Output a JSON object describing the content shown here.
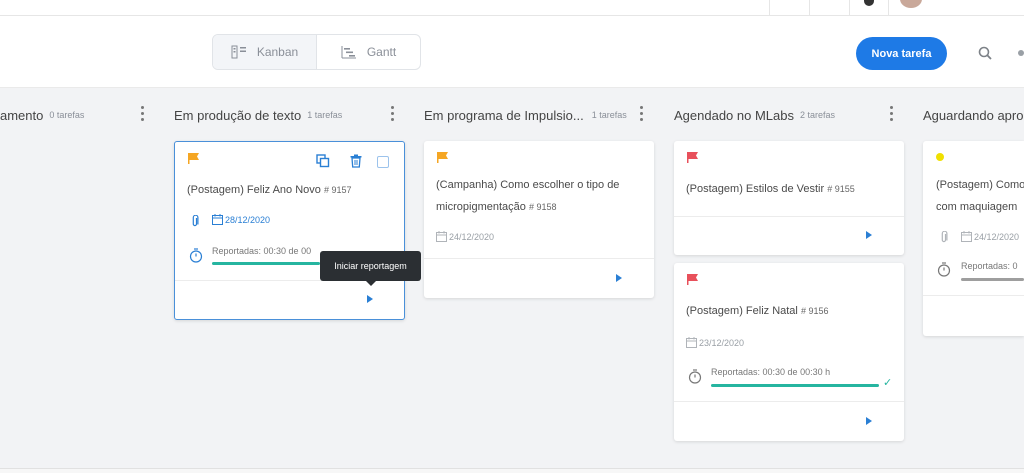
{
  "toolbar": {
    "views": [
      {
        "label": "Kanban",
        "active": true
      },
      {
        "label": "Gantt",
        "active": false
      }
    ],
    "new_task_label": "Nova tarefa"
  },
  "columns": [
    {
      "title": "amento",
      "count": "0 tarefas"
    },
    {
      "title": "Em produção de texto",
      "count": "1 tarefas"
    },
    {
      "title": "Em programa de Impulsio...",
      "count": "1 tarefas"
    },
    {
      "title": "Agendado no MLabs",
      "count": "2 tarefas"
    },
    {
      "title": "Aguardando apro",
      "count": ""
    }
  ],
  "cards": {
    "c1": {
      "title": "(Postagem) Feliz Ano Novo",
      "num": "# 9157",
      "date": "28/12/2020",
      "report": "Reportadas: 00:30 de 00",
      "progress": 1.0,
      "flag_color": "#f5a623"
    },
    "c2": {
      "title_line1": "(Campanha) Como escolher o tipo de",
      "title_line2": "micropigmentação",
      "num": "# 9158",
      "date": "24/12/2020",
      "flag_color": "#f5a623"
    },
    "c3": {
      "title": "(Postagem) Estilos de Vestir",
      "num": "# 9155",
      "flag_color": "#e8505b"
    },
    "c4": {
      "title": "(Postagem) Feliz Natal",
      "num": "# 9156",
      "date": "23/12/2020",
      "report": "Reportadas: 00:30 de 00:30 h",
      "progress": 1.0,
      "flag_color": "#e8505b"
    },
    "c5": {
      "title_line1": "(Postagem) Como",
      "title_line2": "com maquiagem",
      "date": "24/12/2020",
      "report": "Reportadas: 0",
      "dot_color": "#f0e000"
    }
  },
  "tooltip": "Iniciar reportagem"
}
